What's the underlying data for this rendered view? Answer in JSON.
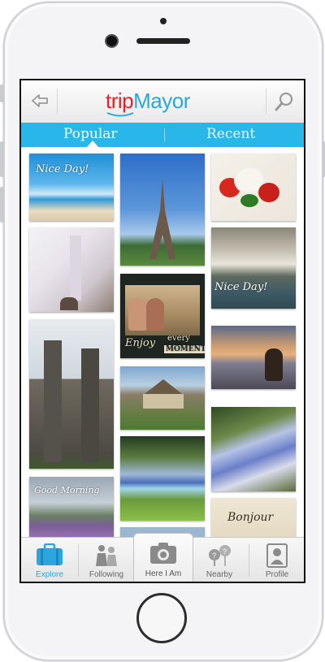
{
  "app": {
    "logo_part1": "trip",
    "logo_part2": "Mayor",
    "brand_red": "#e2232a",
    "brand_blue": "#29a8df"
  },
  "tabs": {
    "popular": "Popular",
    "recent": "Recent",
    "active": "popular",
    "bar_color": "#29b7ea"
  },
  "photos": {
    "nice_day_1": "Nice Day!",
    "enjoy": "Enjoy",
    "every": "every",
    "moment": "MOMENT",
    "nice_day_2": "Nice Day!",
    "good_morning": "Good Morning",
    "bonjour": "Bonjour"
  },
  "tabbar": {
    "explore": "Explore",
    "following": "Following",
    "here_i_am": "Here I Am",
    "nearby": "Nearby",
    "profile": "Profile",
    "active_color": "#2aa5dd"
  }
}
